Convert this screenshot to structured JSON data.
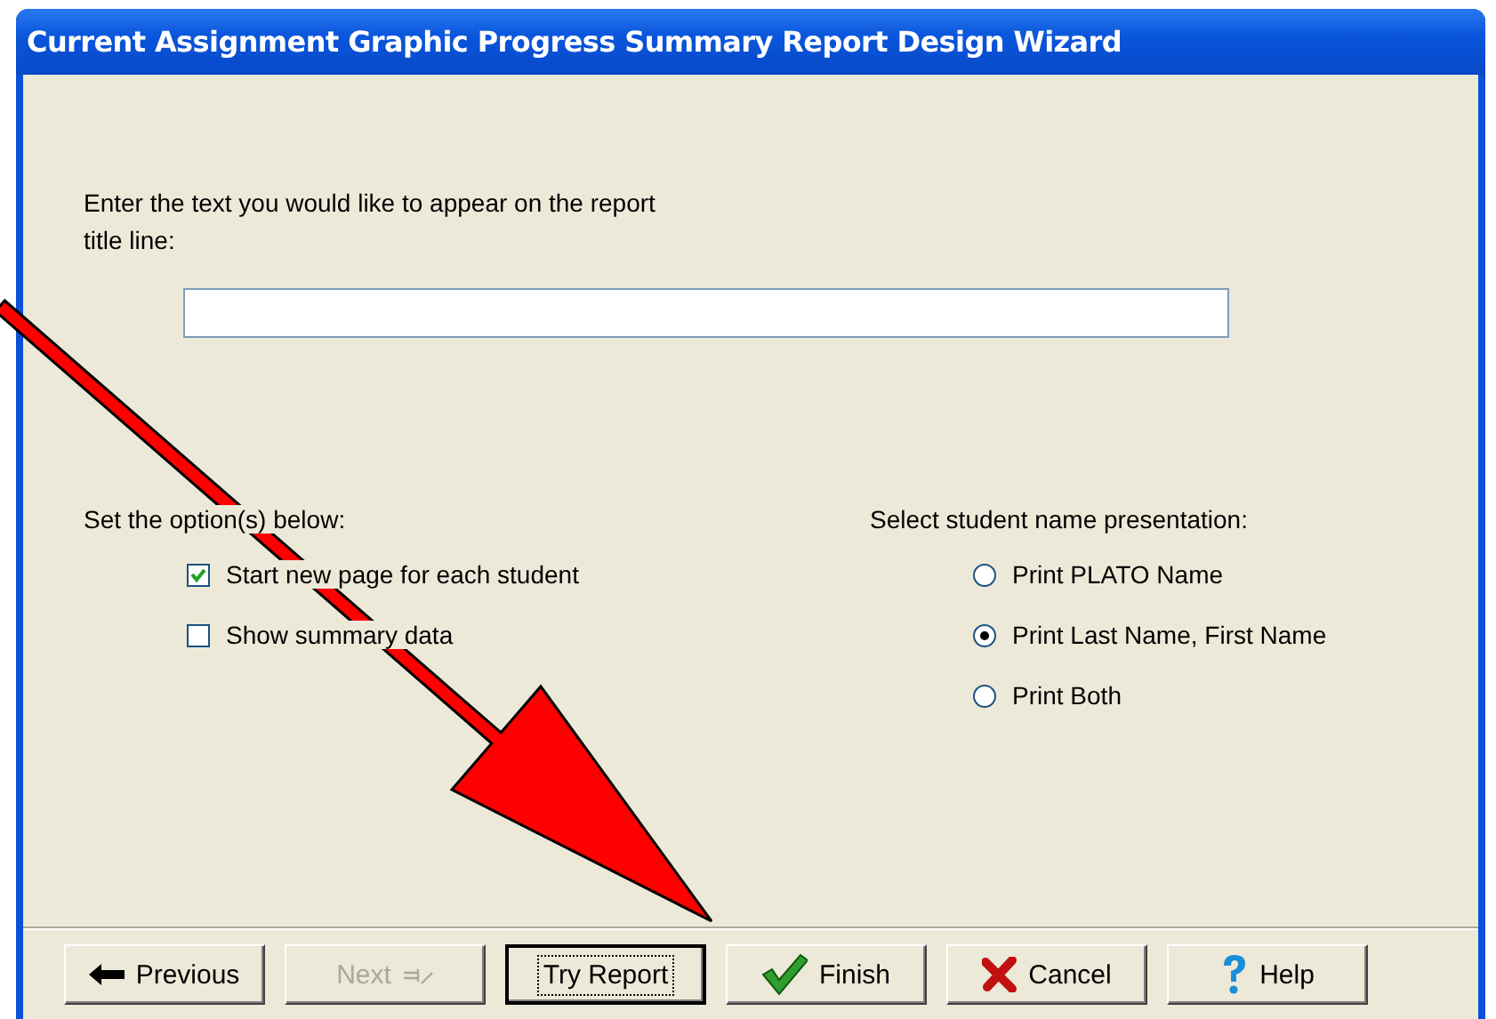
{
  "window": {
    "title": "Current Assignment Graphic Progress Summary Report Design Wizard"
  },
  "prompt": "Enter the text you would like to appear on the report title line:",
  "options": {
    "label": "Set the option(s) below:",
    "items": [
      {
        "label": "Start new page for each student",
        "checked": true
      },
      {
        "label": "Show summary data",
        "checked": false
      }
    ]
  },
  "name_presentation": {
    "label": "Select student name presentation:",
    "items": [
      {
        "label": "Print PLATO Name",
        "selected": false
      },
      {
        "label": "Print Last Name, First Name",
        "selected": true
      },
      {
        "label": "Print Both",
        "selected": false
      }
    ]
  },
  "buttons": [
    {
      "kind": "previous",
      "label": "Previous",
      "disabled": false,
      "focused": false
    },
    {
      "kind": "next",
      "label": "Next",
      "disabled": true,
      "focused": false
    },
    {
      "kind": "try",
      "label": "Try Report",
      "disabled": false,
      "focused": true
    },
    {
      "kind": "finish",
      "label": "Finish",
      "disabled": false,
      "focused": false
    },
    {
      "kind": "cancel",
      "label": "Cancel",
      "disabled": false,
      "focused": false
    },
    {
      "kind": "help",
      "label": "Help",
      "disabled": false,
      "focused": false
    }
  ]
}
